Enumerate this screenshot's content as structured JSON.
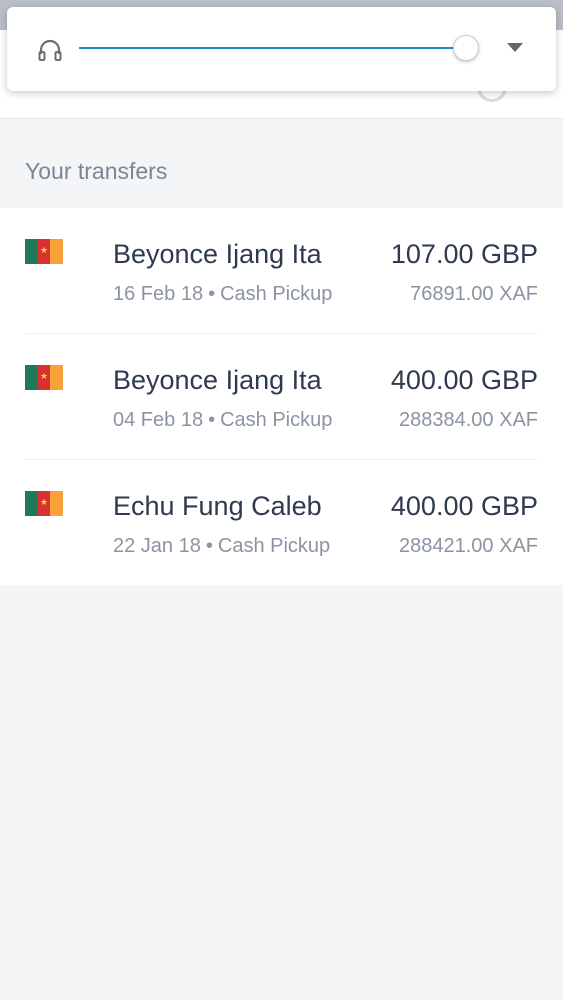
{
  "section_title": "Your transfers",
  "volume_control": {
    "level_percent": 100,
    "icon": "headphone-icon",
    "accent_color": "#1f8ac8"
  },
  "flag": {
    "country": "Cameroon",
    "colors": [
      "#1f7a5a",
      "#d9312f",
      "#f7a23a"
    ],
    "star": "★"
  },
  "meta_separator": "•",
  "transfers": [
    {
      "recipient": "Beyonce Ijang Ita",
      "date": "16 Feb 18",
      "method": "Cash Pickup",
      "amount_sent": "107.00 GBP",
      "amount_received": "76891.00 XAF"
    },
    {
      "recipient": "Beyonce Ijang Ita",
      "date": "04 Feb 18",
      "method": "Cash Pickup",
      "amount_sent": "400.00 GBP",
      "amount_received": "288384.00 XAF"
    },
    {
      "recipient": "Echu Fung Caleb",
      "date": "22 Jan 18",
      "method": "Cash Pickup",
      "amount_sent": "400.00 GBP",
      "amount_received": "288421.00 XAF"
    }
  ]
}
